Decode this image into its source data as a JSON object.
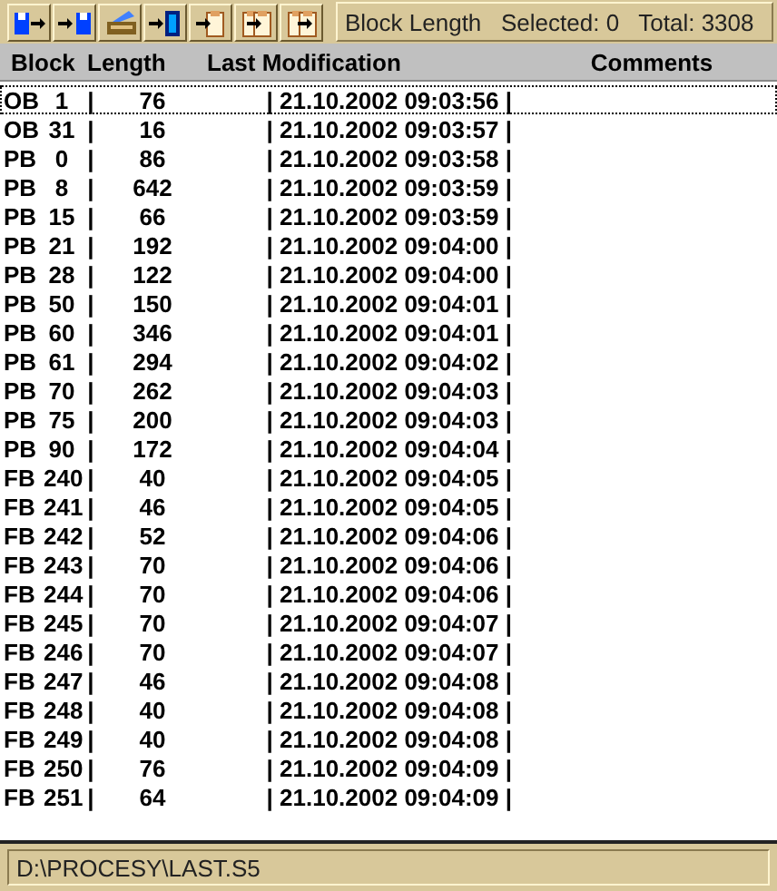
{
  "toolbar": {
    "buttons": [
      {
        "kind": "save-to"
      },
      {
        "kind": "to-save"
      },
      {
        "kind": "print"
      },
      {
        "kind": "to-block"
      },
      {
        "kind": "paste-to"
      },
      {
        "kind": "copy-to"
      },
      {
        "kind": "move-to"
      }
    ],
    "status": "Block Length   Selected: 0   Total: 3308"
  },
  "table": {
    "columns": [
      "Block",
      "Length",
      "Last Modification",
      "Comments"
    ],
    "rows": [
      {
        "type": "OB",
        "number": "1",
        "separator": "|",
        "length": "76",
        "modified": "| 21.10.2002 09:03:56 |",
        "selected": true
      },
      {
        "type": "OB",
        "number": "31",
        "separator": "|",
        "length": "16",
        "modified": "| 21.10.2002 09:03:57 |",
        "selected": false
      },
      {
        "type": "PB",
        "number": "0",
        "separator": "|",
        "length": "86",
        "modified": "| 21.10.2002 09:03:58 |",
        "selected": false
      },
      {
        "type": "PB",
        "number": "8",
        "separator": "|",
        "length": "642",
        "modified": "| 21.10.2002 09:03:59 |",
        "selected": false
      },
      {
        "type": "PB",
        "number": "15",
        "separator": "|",
        "length": "66",
        "modified": "| 21.10.2002 09:03:59 |",
        "selected": false
      },
      {
        "type": "PB",
        "number": "21",
        "separator": "|",
        "length": "192",
        "modified": "| 21.10.2002 09:04:00 |",
        "selected": false
      },
      {
        "type": "PB",
        "number": "28",
        "separator": "|",
        "length": "122",
        "modified": "| 21.10.2002 09:04:00 |",
        "selected": false
      },
      {
        "type": "PB",
        "number": "50",
        "separator": "|",
        "length": "150",
        "modified": "| 21.10.2002 09:04:01 |",
        "selected": false
      },
      {
        "type": "PB",
        "number": "60",
        "separator": "|",
        "length": "346",
        "modified": "| 21.10.2002 09:04:01 |",
        "selected": false
      },
      {
        "type": "PB",
        "number": "61",
        "separator": "|",
        "length": "294",
        "modified": "| 21.10.2002 09:04:02 |",
        "selected": false
      },
      {
        "type": "PB",
        "number": "70",
        "separator": "|",
        "length": "262",
        "modified": "| 21.10.2002 09:04:03 |",
        "selected": false
      },
      {
        "type": "PB",
        "number": "75",
        "separator": "|",
        "length": "200",
        "modified": "| 21.10.2002 09:04:03 |",
        "selected": false
      },
      {
        "type": "PB",
        "number": "90",
        "separator": "|",
        "length": "172",
        "modified": "| 21.10.2002 09:04:04 |",
        "selected": false
      },
      {
        "type": "FB",
        "number": "240",
        "separator": "|",
        "length": "40",
        "modified": "| 21.10.2002 09:04:05 |",
        "selected": false
      },
      {
        "type": "FB",
        "number": "241",
        "separator": "|",
        "length": "46",
        "modified": "| 21.10.2002 09:04:05 |",
        "selected": false
      },
      {
        "type": "FB",
        "number": "242",
        "separator": "|",
        "length": "52",
        "modified": "| 21.10.2002 09:04:06 |",
        "selected": false
      },
      {
        "type": "FB",
        "number": "243",
        "separator": "|",
        "length": "70",
        "modified": "| 21.10.2002 09:04:06 |",
        "selected": false
      },
      {
        "type": "FB",
        "number": "244",
        "separator": "|",
        "length": "70",
        "modified": "| 21.10.2002 09:04:06 |",
        "selected": false
      },
      {
        "type": "FB",
        "number": "245",
        "separator": "|",
        "length": "70",
        "modified": "| 21.10.2002 09:04:07 |",
        "selected": false
      },
      {
        "type": "FB",
        "number": "246",
        "separator": "|",
        "length": "70",
        "modified": "| 21.10.2002 09:04:07 |",
        "selected": false
      },
      {
        "type": "FB",
        "number": "247",
        "separator": "|",
        "length": "46",
        "modified": "| 21.10.2002 09:04:08 |",
        "selected": false
      },
      {
        "type": "FB",
        "number": "248",
        "separator": "|",
        "length": "40",
        "modified": "| 21.10.2002 09:04:08 |",
        "selected": false
      },
      {
        "type": "FB",
        "number": "249",
        "separator": "|",
        "length": "40",
        "modified": "| 21.10.2002 09:04:08 |",
        "selected": false
      },
      {
        "type": "FB",
        "number": "250",
        "separator": "|",
        "length": "76",
        "modified": "| 21.10.2002 09:04:09 |",
        "selected": false
      },
      {
        "type": "FB",
        "number": "251",
        "separator": "|",
        "length": "64",
        "modified": "| 21.10.2002 09:04:09 |",
        "selected": false
      }
    ]
  },
  "status_bar": {
    "path": "D:\\PROCESY\\LAST.S5"
  }
}
